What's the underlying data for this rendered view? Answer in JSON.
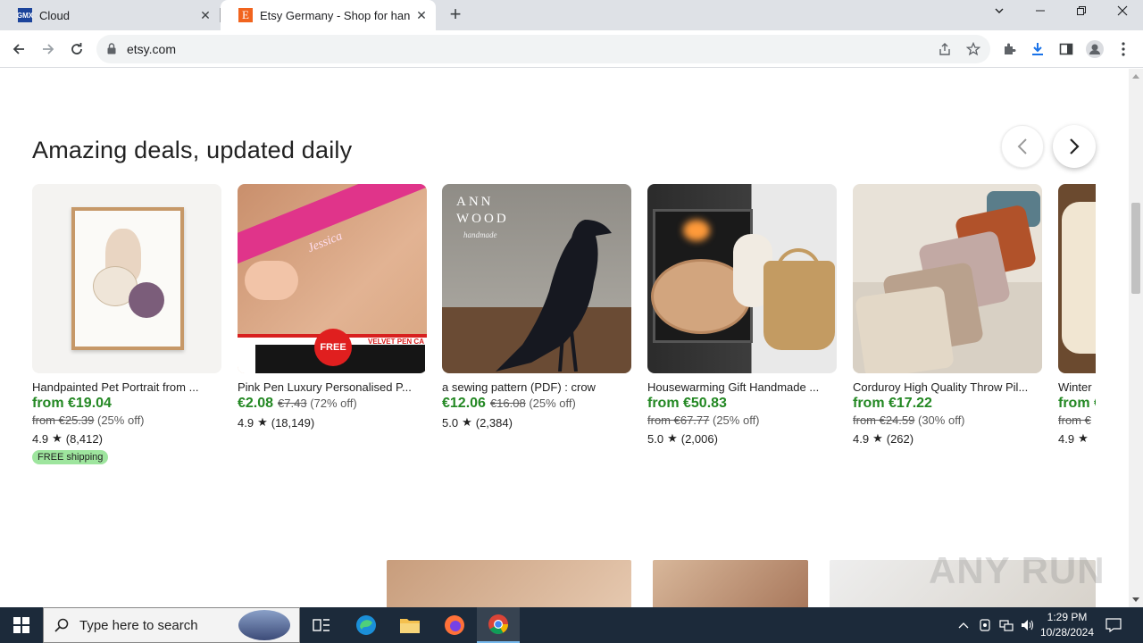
{
  "browser": {
    "tabs": [
      {
        "title": "Cloud",
        "favicon_text": "GMX"
      },
      {
        "title": "Etsy Germany - Shop for handm",
        "favicon_text": "E"
      }
    ],
    "url": "etsy.com"
  },
  "page": {
    "heading": "Amazing deals, updated daily",
    "products": [
      {
        "title": "Handpainted Pet Portrait from ...",
        "price": "from €19.04",
        "original": "from €25.39",
        "discount": "(25% off)",
        "rating": "4.9",
        "reviews": "(8,412)",
        "badge": "FREE shipping"
      },
      {
        "title": "Pink Pen Luxury Personalised P...",
        "price": "€2.08",
        "original": "€7.43",
        "discount": "(72% off)",
        "rating": "4.9",
        "reviews": "(18,149)",
        "image_text": [
          "Jessica",
          "FREE",
          "VELVET PEN CA"
        ]
      },
      {
        "title": "a sewing pattern (PDF) : crow",
        "price": "€12.06",
        "original": "€16.08",
        "discount": "(25% off)",
        "rating": "5.0",
        "reviews": "(2,384)",
        "image_text": [
          "ANN",
          "WOOD",
          "handmade"
        ]
      },
      {
        "title": "Housewarming Gift Handmade ...",
        "price": "from €50.83",
        "original": "from €67.77",
        "discount": "(25% off)",
        "rating": "5.0",
        "reviews": "(2,006)"
      },
      {
        "title": "Corduroy High Quality Throw Pil...",
        "price": "from €17.22",
        "original": "from €24.59",
        "discount": "(30% off)",
        "rating": "4.9",
        "reviews": "(262)"
      },
      {
        "title": "Winter",
        "price": "from €",
        "original": "from €",
        "rating": "4.9"
      }
    ],
    "watermark": "ANY RUN"
  },
  "taskbar": {
    "search_placeholder": "Type here to search",
    "time": "1:29 PM",
    "date": "10/28/2024"
  },
  "colors": {
    "price_green": "#238823",
    "badge_green": "#9ee59e",
    "etsy_orange": "#f1641e",
    "taskbar": "#1c2a3a"
  }
}
